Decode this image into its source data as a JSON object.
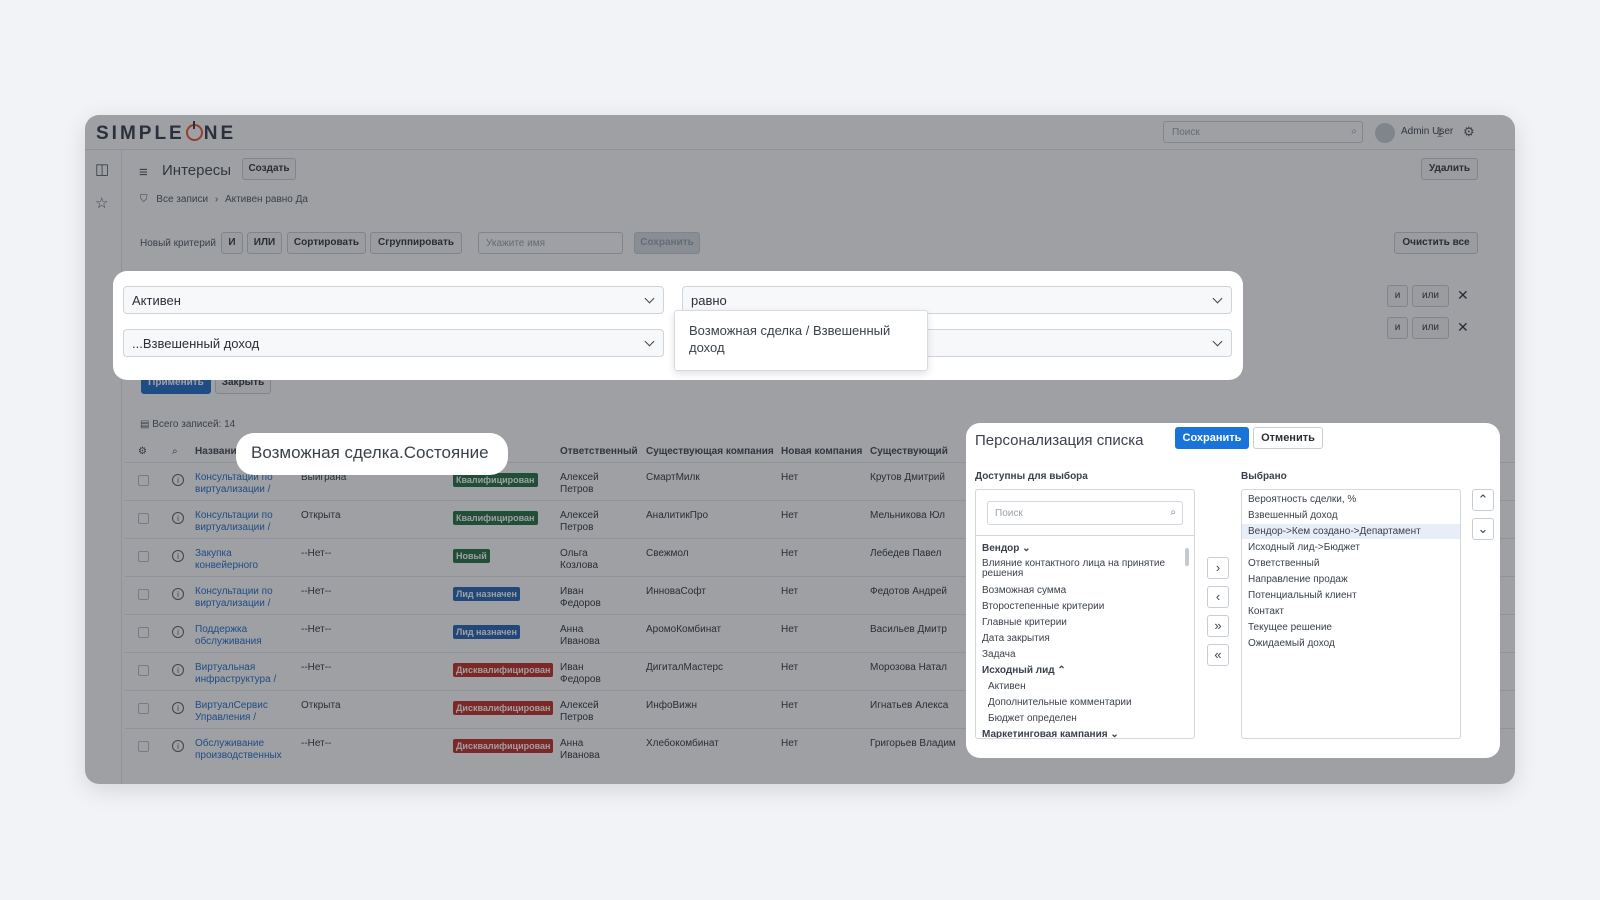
{
  "app": {
    "logo": "SIMPLEONE",
    "search_placeholder": "Поиск",
    "user": "Admin User"
  },
  "page": {
    "title": "Интересы",
    "create": "Создать",
    "delete": "Удалить",
    "breadcrumb_all": "Все записи",
    "breadcrumb_sep": "›",
    "breadcrumb_filter": "Активен равно Да"
  },
  "filter_bar": {
    "new_criterion": "Новый критерий",
    "and": "И",
    "or": "ИЛИ",
    "sort": "Сортировать",
    "group": "Сгруппировать",
    "name_placeholder": "Укажите имя",
    "save": "Сохранить",
    "clear_all": "Очистить все",
    "apply": "Применить",
    "close": "Закрыть",
    "row_and": "и",
    "row_or": "или"
  },
  "filter_card": {
    "field1": "Активен",
    "operator1": "равно",
    "field2": "...Взвешенный доход",
    "dropdown_option": "Возможная сделка / Взвешенный доход"
  },
  "table": {
    "total_label": "Всего записей: 14",
    "columns": [
      "Названи",
      "Ответственный",
      "Существующая компания",
      "Новая компания",
      "Существующий"
    ],
    "rows": [
      {
        "name": "Консультации по виртуализации /",
        "outcome": "Выиграна",
        "status": "Квалифицирован",
        "status_color": "#1d6b3a",
        "owner": "Алексей Петров",
        "company": "СмартМилк",
        "new": "Нет",
        "contact": "Крутов Дмитрий"
      },
      {
        "name": "Консультации по виртуализации /",
        "outcome": "Открыта",
        "status": "Квалифицирован",
        "status_color": "#1d6b3a",
        "owner": "Алексей Петров",
        "company": "АналитикПро",
        "new": "Нет",
        "contact": "Мельникова Юл"
      },
      {
        "name": "Закупка конвейерного",
        "outcome": "--Нет--",
        "status": "Новый",
        "status_color": "#1d6b3a",
        "owner": "Ольга Козлова",
        "company": "Свежмол",
        "new": "Нет",
        "contact": "Лебедев Павел"
      },
      {
        "name": "Консультации по виртуализации /",
        "outcome": "--Нет--",
        "status": "Лид назначен",
        "status_color": "#1e5fb5",
        "owner": "Иван Федоров",
        "company": "ИнноваСофт",
        "new": "Нет",
        "contact": "Федотов Андрей"
      },
      {
        "name": "Поддержка обслуживания",
        "outcome": "--Нет--",
        "status": "Лид назначен",
        "status_color": "#1e5fb5",
        "owner": "Анна Иванова",
        "company": "АромоКомбинат",
        "new": "Нет",
        "contact": "Васильев Дмитр"
      },
      {
        "name": "Виртуальная инфраструктура /",
        "outcome": "--Нет--",
        "status": "Дисквалифицирован",
        "status_color": "#c0261e",
        "owner": "Иван Федоров",
        "company": "ДигиталМастерс",
        "new": "Нет",
        "contact": "Морозова Натал"
      },
      {
        "name": "ВиртуалСервис Управления /",
        "outcome": "Открыта",
        "status": "Дисквалифицирован",
        "status_color": "#c0261e",
        "owner": "Алексей Петров",
        "company": "ИнфоВижн",
        "new": "Нет",
        "contact": "Игнатьев Алекса"
      },
      {
        "name": "Обслуживание производственных",
        "outcome": "--Нет--",
        "status": "Дисквалифицирован",
        "status_color": "#c0261e",
        "owner": "Анна Иванова",
        "company": "Хлебокомбинат",
        "new": "Нет",
        "contact": "Григорьев Владим"
      }
    ]
  },
  "tooltip": "Возможная сделка.Состояние",
  "personalize": {
    "title": "Персонализация списка",
    "save": "Сохранить",
    "cancel": "Отменить",
    "available_label": "Доступны для выбора",
    "selected_label": "Выбрано",
    "search_placeholder": "Поиск",
    "available": [
      {
        "text": "Вендор",
        "group": true
      },
      {
        "text": "Влияние контактного лица на принятие решения",
        "group": false
      },
      {
        "text": "Возможная сумма",
        "group": false
      },
      {
        "text": "Второстепенные критерии",
        "group": false
      },
      {
        "text": "Главные критерии",
        "group": false
      },
      {
        "text": "Дата закрытия",
        "group": false
      },
      {
        "text": "Задача",
        "group": false
      },
      {
        "text": "Исходный лид",
        "group": true
      },
      {
        "text": "Активен",
        "group": false
      },
      {
        "text": "Дополнительные комментарии",
        "group": false
      },
      {
        "text": "Бюджет определен",
        "group": false
      },
      {
        "text": "Маркетинговая кампания",
        "group": true
      }
    ],
    "selected": [
      "Вероятность сделки, %",
      "Взвешенный доход",
      "Вендор->Кем создано->Департамент",
      "Исходный лид->Бюджет",
      "Ответственный",
      "Направление продаж",
      "Потенциальный клиент",
      "Контакт",
      "Текущее решение",
      "Ожидаемый доход"
    ]
  },
  "icons": {
    "accent": "#1a73d9",
    "logo_accent": "#e8532b"
  }
}
